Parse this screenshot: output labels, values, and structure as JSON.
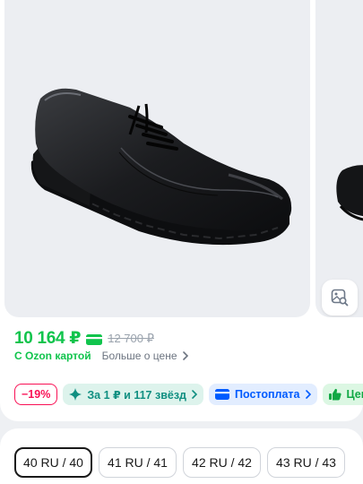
{
  "product": {
    "price": "10 164 ₽",
    "old_price": "12 700 ₽",
    "with_card_label": "С Ozon картой",
    "more_price_label": "Больше о цене"
  },
  "badges": [
    {
      "label": "−19%"
    },
    {
      "label": "За 1 ₽ и 117 звёзд"
    },
    {
      "label": "Постоплата"
    },
    {
      "label": "Цена"
    }
  ],
  "sizes": {
    "items": [
      "40 RU / 40",
      "41 RU / 41",
      "42 RU / 42",
      "43 RU / 43"
    ],
    "selected_index": 0
  },
  "colors": {
    "price_green": "#10c44c",
    "discount_pink": "#f91155",
    "brand_blue": "#005bff"
  },
  "icons": {
    "card": "ozon-card-icon",
    "chevron": "chevron-right-icon",
    "stars": "sparkle-icon",
    "postpay": "postpay-card-icon",
    "thumbs": "thumbs-up-icon",
    "similar": "image-search-icon"
  }
}
